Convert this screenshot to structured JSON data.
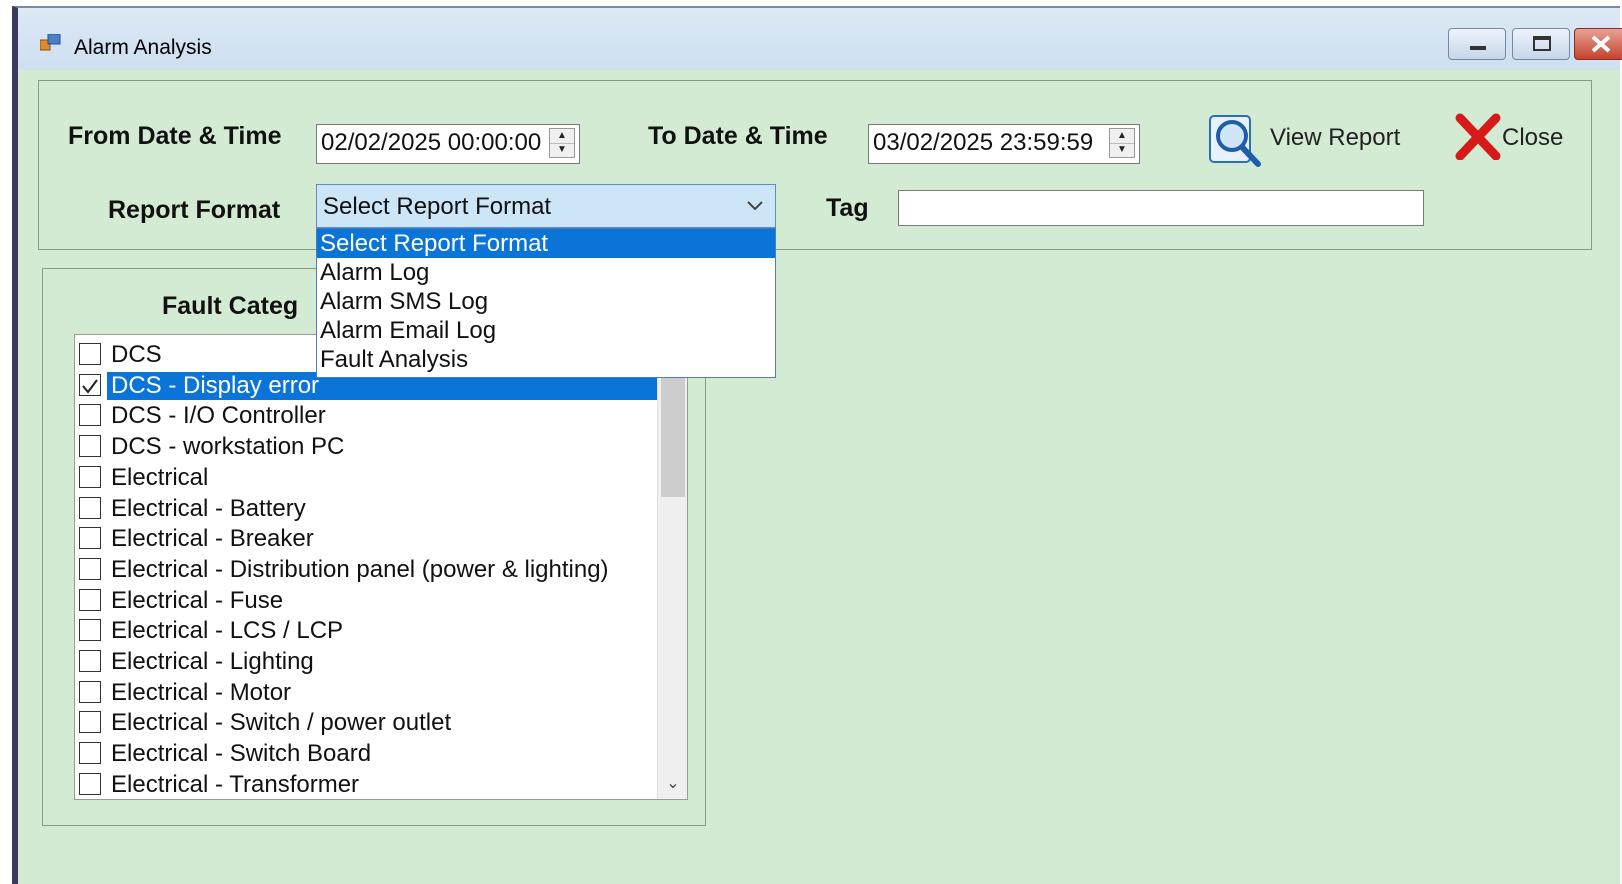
{
  "window": {
    "title": "Alarm Analysis"
  },
  "filters": {
    "from_label": "From Date & Time",
    "from_value": "02/02/2025 00:00:00",
    "to_label": "To Date & Time",
    "to_value": "03/02/2025 23:59:59",
    "report_format_label": "Report Format",
    "report_format_value": "Select Report Format",
    "tag_label": "Tag",
    "tag_value": ""
  },
  "buttons": {
    "view_report": "View Report",
    "close": "Close"
  },
  "report_format_options": [
    "Select Report Format",
    "Alarm Log",
    "Alarm SMS Log",
    "Alarm Email Log",
    "Fault Analysis"
  ],
  "fault": {
    "title": "Fault Categ",
    "items": [
      {
        "label": "DCS",
        "checked": false
      },
      {
        "label": "DCS - Display error",
        "checked": true
      },
      {
        "label": "DCS - I/O Controller",
        "checked": false
      },
      {
        "label": "DCS - workstation PC",
        "checked": false
      },
      {
        "label": "Electrical",
        "checked": false
      },
      {
        "label": "Electrical - Battery",
        "checked": false
      },
      {
        "label": "Electrical - Breaker",
        "checked": false
      },
      {
        "label": "Electrical - Distribution panel (power & lighting)",
        "checked": false
      },
      {
        "label": "Electrical - Fuse",
        "checked": false
      },
      {
        "label": "Electrical - LCS / LCP",
        "checked": false
      },
      {
        "label": "Electrical - Lighting",
        "checked": false
      },
      {
        "label": "Electrical - Motor",
        "checked": false
      },
      {
        "label": "Electrical - Switch / power outlet",
        "checked": false
      },
      {
        "label": "Electrical - Switch Board",
        "checked": false
      },
      {
        "label": "Electrical - Transformer",
        "checked": false
      }
    ]
  }
}
